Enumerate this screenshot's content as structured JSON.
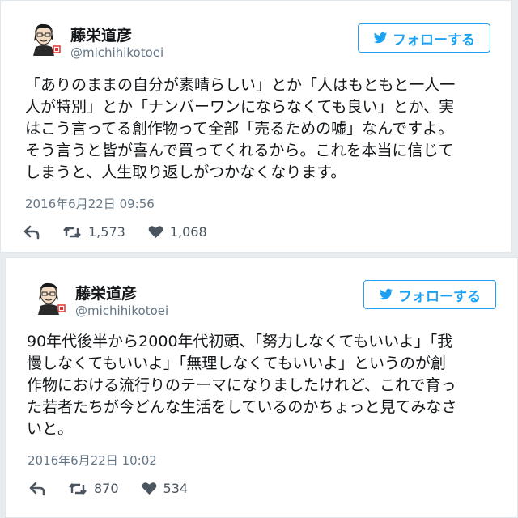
{
  "tweets": [
    {
      "display_name": "藤栄道彦",
      "handle": "@michihikotoei",
      "follow_label": "フォローする",
      "text_lines": [
        "「ありのままの自分が素晴らしい」とか「人はもともと一人一",
        "人が特別」とか「ナンバーワンにならなくても良い」とか、実",
        "はこう言ってる創作物って全部「売るための嘘」なんですよ。",
        "そう言うと皆が喜んで買ってくれるから。これを本当に信じて",
        "しまうと、人生取り返しがつかなくなります。"
      ],
      "date": "2016年6月22日 09:56",
      "retweets": "1,573",
      "likes": "1,068"
    },
    {
      "display_name": "藤栄道彦",
      "handle": "@michihikotoei",
      "follow_label": "フォローする",
      "text_lines": [
        "90年代後半から2000年代初頭、「努力しなくてもいいよ」「我",
        "慢しなくてもいいよ」「無理しなくてもいいよ」というのが創",
        "作物における流行りのテーマになりましたけれど、これで育っ",
        "た若者たちが今どんな生活をしているのかちょっと見てみなさ",
        "いと。"
      ],
      "date": "2016年6月22日 10:02",
      "retweets": "870",
      "likes": "534"
    }
  ],
  "colors": {
    "accent": "#1da1f2",
    "text": "#14171a",
    "muted": "#657786",
    "background": "#e9ecef"
  },
  "icons": {
    "follow": "twitter-bird-icon",
    "reply": "reply-icon",
    "retweet": "retweet-icon",
    "like": "heart-icon"
  }
}
